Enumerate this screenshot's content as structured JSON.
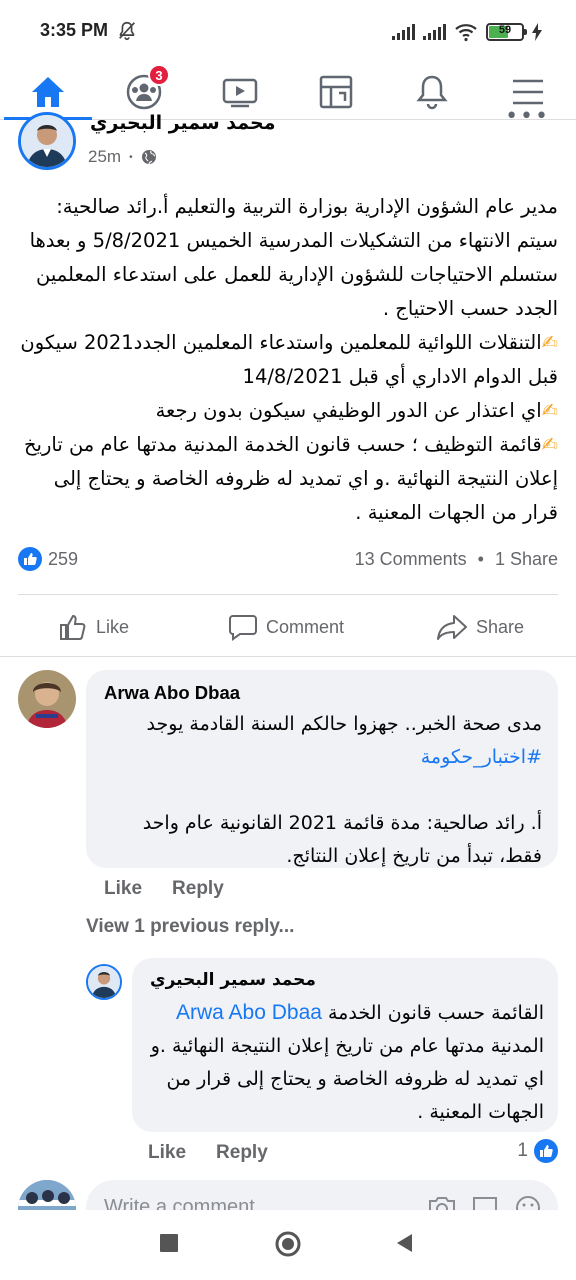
{
  "status_bar": {
    "time": "3:35 PM",
    "battery_level": "59",
    "battery_fraction": 0.59
  },
  "nav": {
    "items": [
      {
        "name": "home",
        "active": true
      },
      {
        "name": "friends",
        "badge": "3"
      },
      {
        "name": "watch"
      },
      {
        "name": "marketplace"
      },
      {
        "name": "notifications"
      },
      {
        "name": "menu"
      }
    ]
  },
  "post": {
    "author": "محمد سمير البحيري",
    "time": "25m",
    "paragraphs": [
      "مدير عام الشؤون الإدارية بوزارة التربية والتعليم أ.رائد صالحية: سيتم الانتهاء من التشكيلات المدرسية الخميس  5/8/2021  و بعدها ستسلم الاحتياجات للشؤون الإدارية للعمل على استدعاء المعلمين الجدد حسب الاحتياج .",
      "التنقلات اللوائية للمعلمين  واستدعاء المعلمين الجدد2021 سيكون  قبل الدوام الاداري أي قبل 14/8/2021",
      "اي اعتذار عن الدور الوظيفي سيكون بدون رجعة",
      "قائمة التوظيف ؛  حسب قانون الخدمة المدنية مدتها عام من تاريخ إعلان النتيجة النهائية .و اي تمديد له ظروفه الخاصة و يحتاج إلى قرار من الجهات المعنية ."
    ],
    "reaction_count": "259",
    "comments_count": "13 Comments",
    "shares_count": "1 Share",
    "separator": "•"
  },
  "actions": {
    "like": "Like",
    "comment": "Comment",
    "share": "Share"
  },
  "comments": [
    {
      "author": "Arwa Abo Dbaa",
      "line1": "مدى صحة الخبر.. جهزوا حالكم السنة القادمة يوجد",
      "hashtag": "#اختبار_حكومة",
      "line2": "أ. رائد صالحية:  مدة قائمة 2021 القانونية عام واحد فقط، تبدأ من تاريخ إعلان النتائج.",
      "like": "Like",
      "reply": "Reply"
    }
  ],
  "view_previous": "View 1 previous reply...",
  "reply": {
    "author": "محمد سمير البحيري",
    "mention": "Arwa Abo Dbaa",
    "text_after_mention": "القائمة حسب قانون الخدمة",
    "text": "المدنية مدتها عام من تاريخ إعلان النتيجة النهائية .و اي تمديد له ظروفه الخاصة و يحتاج إلى قرار من الجهات المعنية .",
    "like": "Like",
    "reply": "Reply",
    "like_count": "1"
  },
  "write_comment": {
    "placeholder": "Write a comment..."
  },
  "colors": {
    "accent": "#1877f2",
    "badge": "#e41e3f",
    "secondary_text": "#65676b",
    "bubble": "#f0f2f5"
  }
}
